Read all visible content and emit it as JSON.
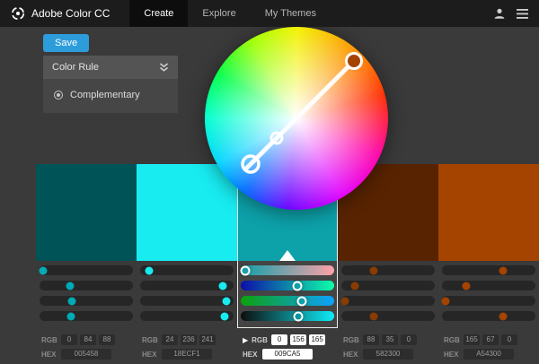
{
  "header": {
    "brand": "Adobe Color CC",
    "nav": [
      {
        "label": "Create",
        "active": true
      },
      {
        "label": "Explore",
        "active": false
      },
      {
        "label": "My Themes",
        "active": false
      }
    ]
  },
  "toolbar": {
    "save_label": "Save"
  },
  "color_rule": {
    "header": "Color Rule",
    "selected_rule": "Complementary"
  },
  "labels": {
    "rgb": "RGB",
    "hex": "HEX"
  },
  "swatches": [
    {
      "hex": "005458",
      "rgb": [
        "0",
        "84",
        "88"
      ],
      "selected": false
    },
    {
      "hex": "18ECF1",
      "rgb": [
        "24",
        "236",
        "241"
      ],
      "selected": false
    },
    {
      "hex": "009CA5",
      "rgb": [
        "0",
        "156",
        "165"
      ],
      "selected": true
    },
    {
      "hex": "582300",
      "rgb": [
        "88",
        "35",
        "0"
      ],
      "selected": false
    },
    {
      "hex": "A54300",
      "rgb": [
        "165",
        "67",
        "0"
      ],
      "selected": false
    }
  ],
  "colors": {
    "accent_blue": "#2D9CDB",
    "header_bg": "#1c1c1c",
    "workspace_bg": "#3a3a3a",
    "swatch_1": "#005458",
    "swatch_2": "#18ECF1",
    "swatch_3": "#009CA5",
    "swatch_4": "#582300",
    "swatch_5": "#A54300"
  },
  "icons": {
    "logo": "adobe-color-logo",
    "user": "user-icon",
    "menu": "menu-icon",
    "chevron": "double-chevron-down-icon",
    "mode_toggle": "play-arrow-icon"
  }
}
